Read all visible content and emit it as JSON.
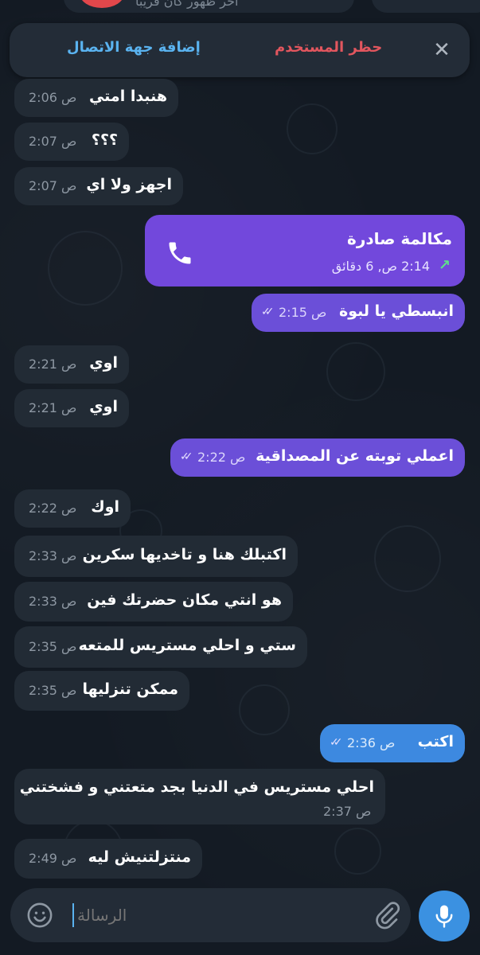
{
  "top": {
    "status": "آخر ظهور كان قريبًا"
  },
  "action_bar": {
    "block_label": "حظر المستخدم",
    "add_label": "إضافة جهة الاتصال",
    "close_icon": "close-icon"
  },
  "messages": [
    {
      "text": "هنبدا امتي",
      "time": "2:06 ص"
    },
    {
      "text": "؟؟؟",
      "time": "2:07 ص"
    },
    {
      "text": "اجهز ولا اي",
      "time": "2:07 ص"
    },
    {
      "call_title": "مكالمة صادرة",
      "call_detail": "2:14 ص, 6 دقائق"
    },
    {
      "text": "انبسطي يا لبوة",
      "time": "2:15 ص"
    },
    {
      "text": "اوي",
      "time": "2:21 ص"
    },
    {
      "text": "اوي",
      "time": "2:21 ص"
    },
    {
      "text": "اعملي توبته عن المصداقية",
      "time": "2:22 ص"
    },
    {
      "text": "اوك",
      "time": "2:22 ص"
    },
    {
      "text": "اكتبلك هنا و تاخديها سكرين",
      "time": "2:33 ص"
    },
    {
      "text": "هو انتي مكان حضرتك فين",
      "time": "2:33 ص"
    },
    {
      "text": "ستي و احلي مستريس للمتعه",
      "time": "2:35 ص"
    },
    {
      "text": "ممكن تنزليها",
      "time": "2:35 ص"
    },
    {
      "text": "اكتب",
      "time": "2:36 ص"
    },
    {
      "text": "احلي مستريس في الدنيا بجد متعتني و فشختني",
      "time": "2:37 ص"
    },
    {
      "text": "منتزلتنيش ليه",
      "time": "2:49 ص"
    }
  ],
  "composer": {
    "placeholder": "الرسالة"
  },
  "colors": {
    "outgoing": "#6b4fd8",
    "incoming": "#222b35",
    "accent": "#3b91e1",
    "danger": "#e2565e",
    "link": "#5ab3f0"
  }
}
